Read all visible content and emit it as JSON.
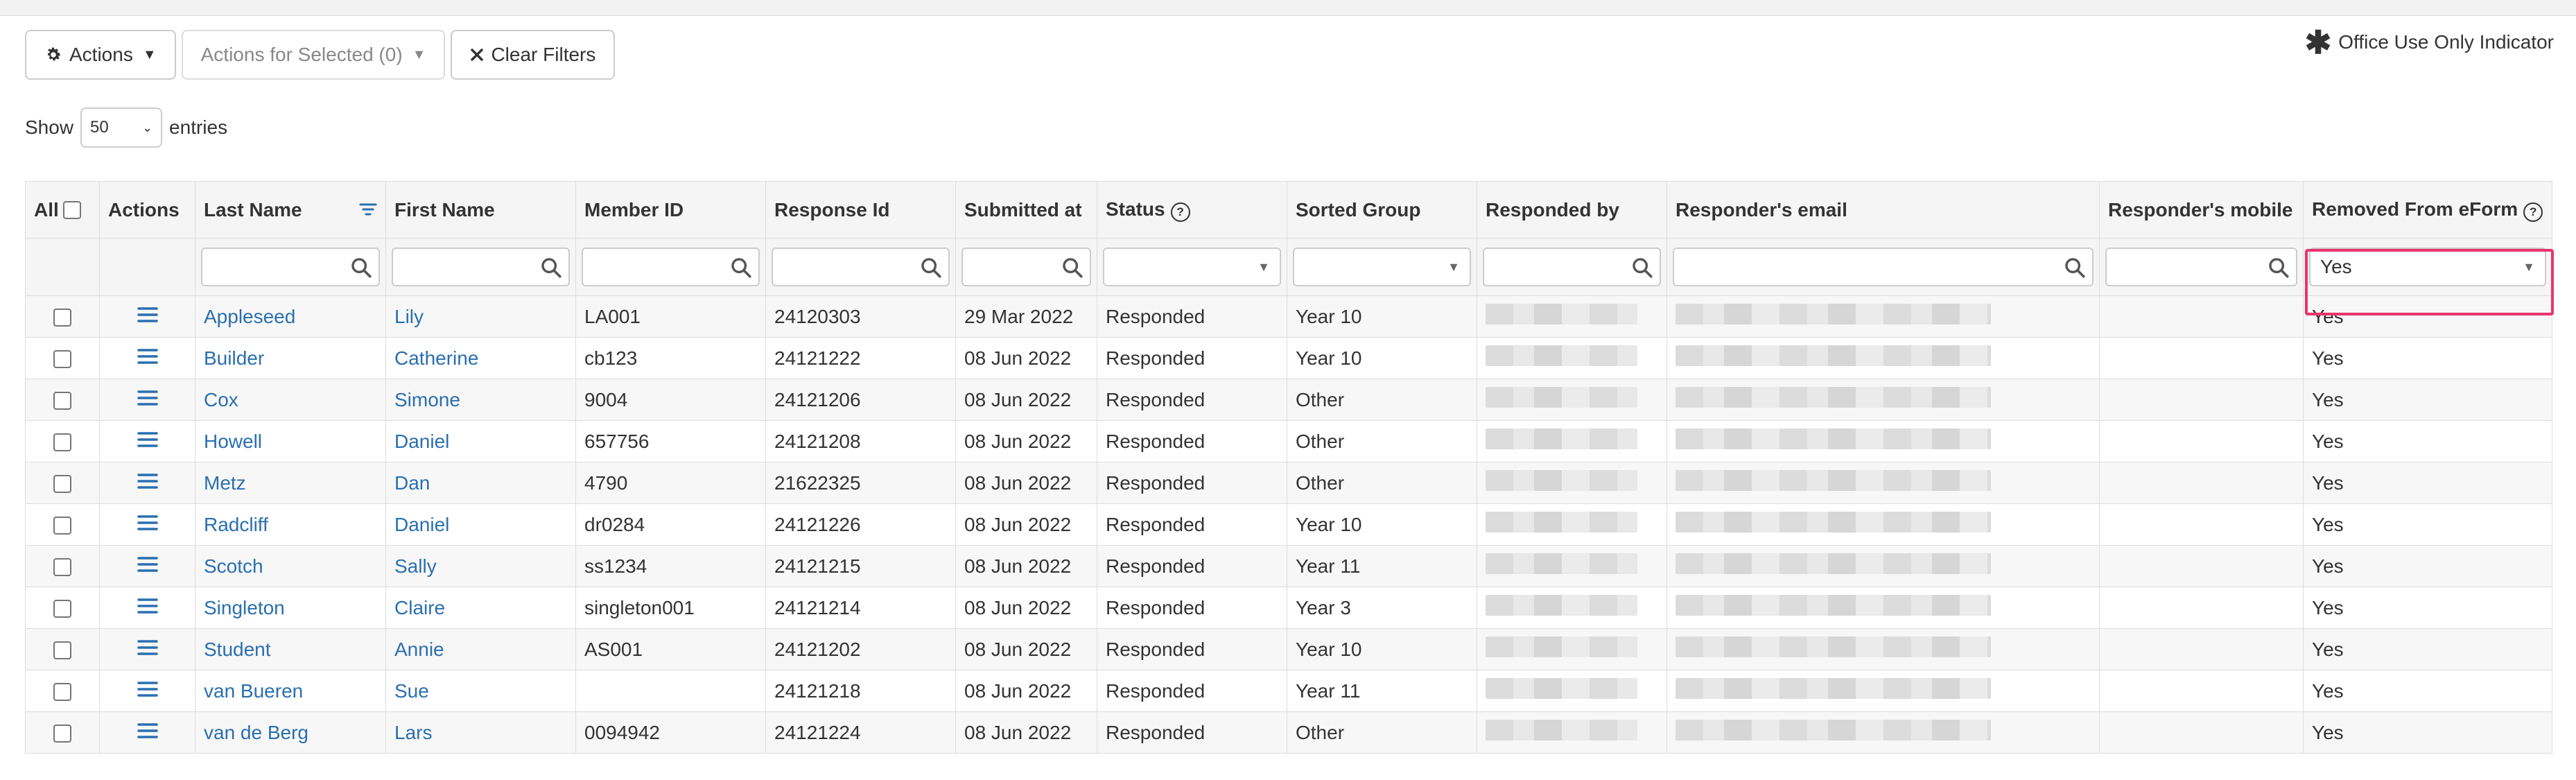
{
  "toolbar": {
    "actions_label": "Actions",
    "actions_selected_label": "Actions for Selected (0)",
    "clear_filters_label": "Clear Filters"
  },
  "office_indicator": {
    "label": "Office Use Only Indicator"
  },
  "length": {
    "show_label": "Show",
    "value": "50",
    "entries_label": "entries"
  },
  "table": {
    "headers": {
      "all": "All",
      "actions": "Actions",
      "last_name": "Last Name",
      "first_name": "First Name",
      "member_id": "Member ID",
      "response_id": "Response Id",
      "submitted_at": "Submitted at",
      "status": "Status",
      "sorted_group": "Sorted Group",
      "responded_by": "Responded by",
      "responder_email": "Responder's email",
      "responder_mobile": "Responder's mobile",
      "removed_from_eform": "Removed From eForm"
    },
    "filters": {
      "removed_value": "Yes"
    },
    "rows": [
      {
        "last": "Appleseed",
        "first": "Lily",
        "member": "LA001",
        "response": "24120303",
        "submitted": "29 Mar 2022",
        "status": "Responded",
        "group": "Year 10",
        "removed": "Yes"
      },
      {
        "last": "Builder",
        "first": "Catherine",
        "member": "cb123",
        "response": "24121222",
        "submitted": "08 Jun 2022",
        "status": "Responded",
        "group": "Year 10",
        "removed": "Yes"
      },
      {
        "last": "Cox",
        "first": "Simone",
        "member": "9004",
        "response": "24121206",
        "submitted": "08 Jun 2022",
        "status": "Responded",
        "group": "Other",
        "removed": "Yes"
      },
      {
        "last": "Howell",
        "first": "Daniel",
        "member": "657756",
        "response": "24121208",
        "submitted": "08 Jun 2022",
        "status": "Responded",
        "group": "Other",
        "removed": "Yes"
      },
      {
        "last": "Metz",
        "first": "Dan",
        "member": "4790",
        "response": "21622325",
        "submitted": "08 Jun 2022",
        "status": "Responded",
        "group": "Other",
        "removed": "Yes"
      },
      {
        "last": "Radcliff",
        "first": "Daniel",
        "member": "dr0284",
        "response": "24121226",
        "submitted": "08 Jun 2022",
        "status": "Responded",
        "group": "Year 10",
        "removed": "Yes"
      },
      {
        "last": "Scotch",
        "first": "Sally",
        "member": "ss1234",
        "response": "24121215",
        "submitted": "08 Jun 2022",
        "status": "Responded",
        "group": "Year 11",
        "removed": "Yes"
      },
      {
        "last": "Singleton",
        "first": "Claire",
        "member": "singleton001",
        "response": "24121214",
        "submitted": "08 Jun 2022",
        "status": "Responded",
        "group": "Year 3",
        "removed": "Yes"
      },
      {
        "last": "Student",
        "first": "Annie",
        "member": "AS001",
        "response": "24121202",
        "submitted": "08 Jun 2022",
        "status": "Responded",
        "group": "Year 10",
        "removed": "Yes"
      },
      {
        "last": "van Bueren",
        "first": "Sue",
        "member": "",
        "response": "24121218",
        "submitted": "08 Jun 2022",
        "status": "Responded",
        "group": "Year 11",
        "removed": "Yes"
      },
      {
        "last": "van de Berg",
        "first": "Lars",
        "member": "0094942",
        "response": "24121224",
        "submitted": "08 Jun 2022",
        "status": "Responded",
        "group": "Other",
        "removed": "Yes"
      }
    ]
  },
  "colors": {
    "link": "#2a6fb0",
    "highlight": "#e8356d",
    "header_bg": "#f5f5f5",
    "border": "#dddddd"
  },
  "icons": [
    "gear-icon",
    "caret-down-icon",
    "close-icon",
    "asterisk-icon",
    "sort-icon",
    "help-icon",
    "search-icon",
    "hamburger-menu-icon"
  ]
}
